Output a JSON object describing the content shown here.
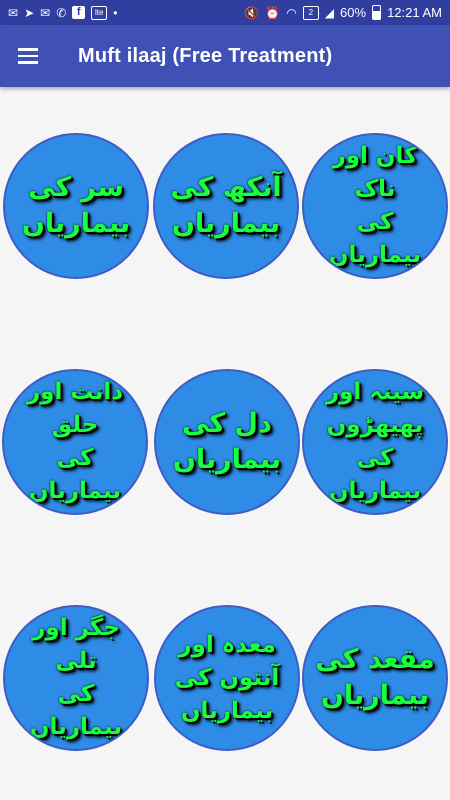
{
  "status_bar": {
    "battery_percent": "60%",
    "time": "12:21 AM",
    "sim_badge": "2",
    "lte_badge": "lte",
    "facebook_glyph": "f"
  },
  "app_bar": {
    "title": "Muft ilaaj (Free Treatment)"
  },
  "categories": [
    {
      "label": "سر کی\nبیماریاں"
    },
    {
      "label": "آنکھ کی\nبیماریاں"
    },
    {
      "label": "کان اور ناک\nکی بیماریاں"
    },
    {
      "label": "دانت اور حلق\nکی بیماریاں"
    },
    {
      "label": "دل کی\nبیماریاں"
    },
    {
      "label": "سینہ اور\nپھیھڑوں\nکی بیماریاں"
    },
    {
      "label": "جگر اور تلی\nکی بیماریاں"
    },
    {
      "label": "معدہ اور\nآنتوں کی\nبیماریاں"
    },
    {
      "label": "مقعد کی\nبیماریاں"
    }
  ],
  "colors": {
    "status_bar": "#303f9f",
    "app_bar": "#3f51b5",
    "circle_fill": "#2f8ce6",
    "label_text": "#18ff3b"
  }
}
